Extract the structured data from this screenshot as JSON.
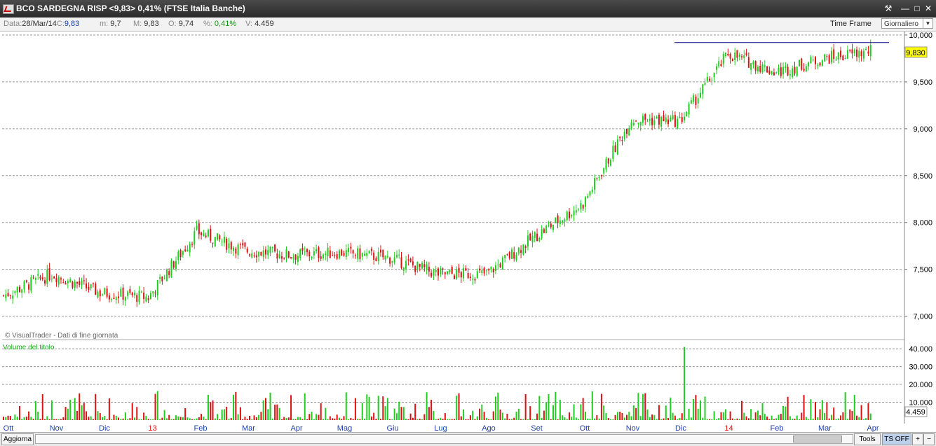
{
  "window": {
    "title": "BCO SARDEGNA RISP <9,83> 0,41%  (FTSE Italia Banche)",
    "buttons": [
      "⚒",
      "—",
      "□",
      "✕"
    ]
  },
  "infobar": {
    "data_label": "Data:",
    "data_value": "28/Mar/14",
    "c_label": "C:",
    "c_value": "9,83",
    "m_label": "m:",
    "m_value": "9,7",
    "M_label": "M:",
    "M_value": "9,83",
    "o_label": "O:",
    "o_value": "9,74",
    "pct_label": "%:",
    "pct_value": "0,41%",
    "v_label": "V:",
    "v_value": "4.459",
    "time_frame_label": "Time Frame",
    "time_frame_value": "Giornaliero"
  },
  "colors": {
    "up": "#22cc22",
    "down": "#dd1111",
    "last_price_bg": "#ffff00",
    "resistance_line": "#000080",
    "volume_label": "#22aa22",
    "month_label": "#2244aa",
    "year_label": "#dd1111"
  },
  "chart_data": [
    {
      "type": "candlestick",
      "title": "BCO SARDEGNA RISP",
      "credit": "© VisualTrader - Dati di fine giornata",
      "ylim": [
        6.9,
        10.0
      ],
      "y_ticks": [
        "7,000",
        "7,500",
        "8,000",
        "8,500",
        "9,000",
        "9,500",
        "10,000"
      ],
      "y_tick_values": [
        7.0,
        7.5,
        8.0,
        8.5,
        9.0,
        9.5,
        10.0
      ],
      "last_price": "9,830",
      "last_price_value": 9.83,
      "resistance_level": 9.92,
      "grid": true,
      "monthly_close": [
        {
          "month": "Ott",
          "close": 7.22
        },
        {
          "month": "Nov",
          "close": 7.45
        },
        {
          "month": "Dic",
          "close": 7.25
        },
        {
          "month": "13",
          "close": 7.2
        },
        {
          "month": "Feb",
          "close": 7.9
        },
        {
          "month": "Mar",
          "close": 7.7
        },
        {
          "month": "Apr",
          "close": 7.65
        },
        {
          "month": "Mag",
          "close": 7.68
        },
        {
          "month": "Giu",
          "close": 7.62
        },
        {
          "month": "Lug",
          "close": 7.45
        },
        {
          "month": "Ago",
          "close": 7.45
        },
        {
          "month": "Set",
          "close": 7.85
        },
        {
          "month": "Ott",
          "close": 8.2
        },
        {
          "month": "Nov",
          "close": 9.1
        },
        {
          "month": "Dic",
          "close": 9.08
        },
        {
          "month": "14",
          "close": 9.8
        },
        {
          "month": "Feb",
          "close": 9.6
        },
        {
          "month": "Mar",
          "close": 9.75
        },
        {
          "month": "Apr",
          "close": 9.83
        }
      ]
    },
    {
      "type": "bar",
      "title": "Volume del titolo",
      "ylim": [
        0,
        42000
      ],
      "y_ticks": [
        "10.000",
        "20.000",
        "30.000",
        "40.000"
      ],
      "y_tick_values": [
        10000,
        20000,
        30000,
        40000
      ],
      "last_volume": "4.459",
      "peak_volume": 41000
    }
  ],
  "x_axis": {
    "labels": [
      "Ott",
      "Nov",
      "Dic",
      "13",
      "Feb",
      "Mar",
      "Apr",
      "Mag",
      "Giu",
      "Lug",
      "Ago",
      "Set",
      "Ott",
      "Nov",
      "Dic",
      "14",
      "Feb",
      "Mar",
      "Apr"
    ],
    "year_labels": [
      "13",
      "14"
    ]
  },
  "bottombar": {
    "refresh_label": "Aggiorna",
    "tools_label": "Tools",
    "ts_label": "TS OFF",
    "zoom_in": "+",
    "zoom_out": "−",
    "scroll_left": "<",
    "scroll_right": ">"
  }
}
